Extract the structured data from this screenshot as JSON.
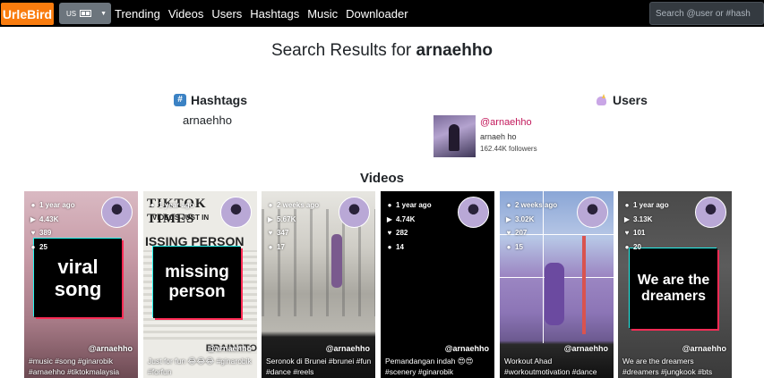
{
  "nav": {
    "brand": "UrleBird",
    "region": "US",
    "links": [
      "Trending",
      "Videos",
      "Users",
      "Hashtags",
      "Music",
      "Downloader"
    ],
    "search_placeholder": "Search @user or #hash"
  },
  "page": {
    "title_prefix": "Search Results for",
    "query": "arnaehho"
  },
  "hashtags": {
    "heading": "Hashtags",
    "items": [
      "arnaehho"
    ]
  },
  "users": {
    "heading": "Users",
    "items": [
      {
        "handle": "@arnaehho",
        "name": "arnaeh ho",
        "followers": "162.44K followers"
      }
    ]
  },
  "videos": {
    "heading": "Videos",
    "items": [
      {
        "age": "1 year ago",
        "views": "4.43K",
        "likes": "389",
        "comments": "25",
        "author": "@arnaehho",
        "overlay": "viral song",
        "desc": "#music #song #ginarobik #arnaehho #tiktokmalaysia"
      },
      {
        "age": "1 year ago",
        "views": "",
        "likes": "",
        "comments": "",
        "author": "@arnaehho",
        "overlay": "missing person",
        "desc": "Just for fun 😂😂😂 #ginarobik #forfun",
        "bg_text": "TIKTOK TIMES",
        "bg_text2": "VIDEOS JUST IN",
        "bg_text3": "ISSING PERSON",
        "bg_text4": "BRAINSTO"
      },
      {
        "age": "2 weeks ago",
        "views": "5.67K",
        "likes": "347",
        "comments": "17",
        "author": "@arnaehho",
        "overlay": "",
        "desc": "Seronok di Brunei #brunei #fun #dance #reels"
      },
      {
        "age": "1 year ago",
        "views": "4.74K",
        "likes": "282",
        "comments": "14",
        "author": "@arnaehho",
        "overlay": "",
        "desc": "Pemandangan indah 😍😍 #scenery #ginarobik"
      },
      {
        "age": "2 weeks ago",
        "views": "3.02K",
        "likes": "207",
        "comments": "15",
        "author": "@arnaehho",
        "overlay": "",
        "desc": "Workout Ahad #workoutmotivation #dance"
      },
      {
        "age": "1 year ago",
        "views": "3.13K",
        "likes": "101",
        "comments": "20",
        "author": "@arnaehho",
        "overlay": "We are the dreamers",
        "desc": "We are the dreamers #dreamers #jungkook #bts"
      }
    ]
  },
  "colors": {
    "brand": "#f97c0e",
    "navbar": "#000000",
    "handle": "#c2185b",
    "tiktok_red": "#fe2c55",
    "tiktok_cyan": "#25f4ee"
  }
}
